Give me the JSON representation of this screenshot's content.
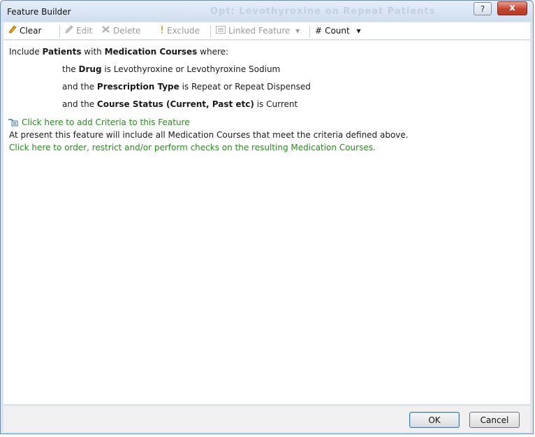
{
  "window": {
    "title": "Feature Builder",
    "background_title": "Opt: Levothyroxine on Repeat Patients",
    "help_glyph": "?",
    "close_glyph": "x"
  },
  "toolbar": {
    "clear": "Clear",
    "edit": "Edit",
    "delete": "Delete",
    "exclude": "Exclude",
    "linked_feature": "Linked Feature",
    "count": "Count",
    "count_glyph": "#",
    "dropdown_glyph": "▾"
  },
  "criteria": {
    "line1": {
      "p1": "Include ",
      "p2": "Patients",
      "p3": " with ",
      "p4": "Medication Courses",
      "p5": " where:"
    },
    "line2": {
      "p1": "the ",
      "p2": "Drug",
      "p3": " is ",
      "p4": "Levothyroxine or Levothyroxine Sodium"
    },
    "line3": {
      "p1": "and the ",
      "p2": "Prescription Type",
      "p3": " is ",
      "p4": "Repeat or Repeat Dispensed"
    },
    "line4": {
      "p1": "and the ",
      "p2": "Course Status (Current, Past etc)",
      "p3": " is ",
      "p4": "Current"
    }
  },
  "links": {
    "add_criteria": "Click here to add Criteria to this Feature",
    "info": "At present this feature will include all Medication Courses that meet the criteria defined above.",
    "order_restrict": "Click here to order, restrict and/or perform checks on the resulting Medication Courses."
  },
  "buttons": {
    "ok": "OK",
    "cancel": "Cancel"
  },
  "colors": {
    "link_green": "#2a8a1f",
    "close_red": "#c5442f",
    "frame_blue": "#dce6f2"
  }
}
